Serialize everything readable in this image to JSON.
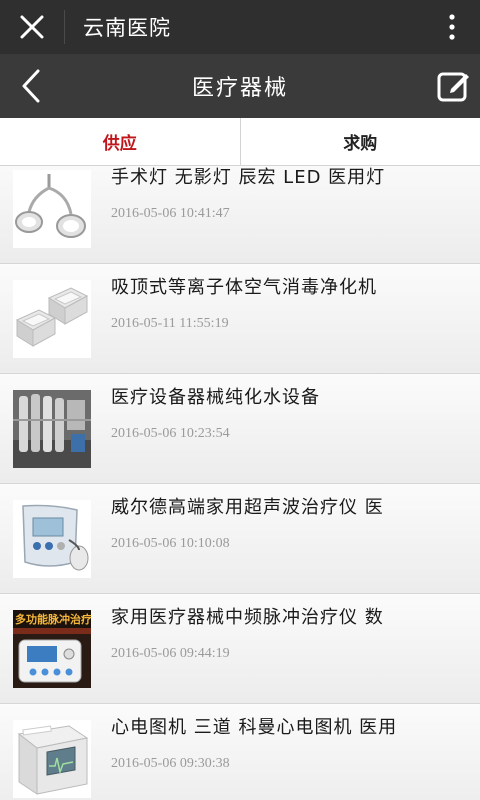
{
  "wechat_bar": {
    "title": "云南医院"
  },
  "header": {
    "title": "医疗器械"
  },
  "tabs": [
    {
      "label": "供应",
      "active": true
    },
    {
      "label": "求购",
      "active": false
    }
  ],
  "items": [
    {
      "title": "手术灯 无影灯 辰宏 LED 医用灯",
      "date": "2016-05-06 10:41:47",
      "thumb_icon": "surgical-lamp"
    },
    {
      "title": "吸顶式等离子体空气消毒净化机",
      "date": "2016-05-11 11:55:19",
      "thumb_icon": "air-purifier"
    },
    {
      "title": "医疗设备器械纯化水设备",
      "date": "2016-05-06 10:23:54",
      "thumb_icon": "water-purifier"
    },
    {
      "title": "威尔德高端家用超声波治疗仪 医",
      "date": "2016-05-06 10:10:08",
      "thumb_icon": "ultrasound-device"
    },
    {
      "title": "家用医疗器械中频脉冲治疗仪 数",
      "date": "2016-05-06 09:44:19",
      "thumb_icon": "pulse-therapy-device"
    },
    {
      "title": "心电图机 三道 科曼心电图机 医用",
      "date": "2016-05-06 09:30:38",
      "thumb_icon": "ecg-machine"
    }
  ],
  "thumb_caption": {
    "title": "多功能脉冲治疗仪"
  },
  "colors": {
    "active_tab": "#c0161b",
    "wechat_bar": "#2f2f2f",
    "header": "#3a3a3a",
    "date": "#9a9a9a"
  }
}
